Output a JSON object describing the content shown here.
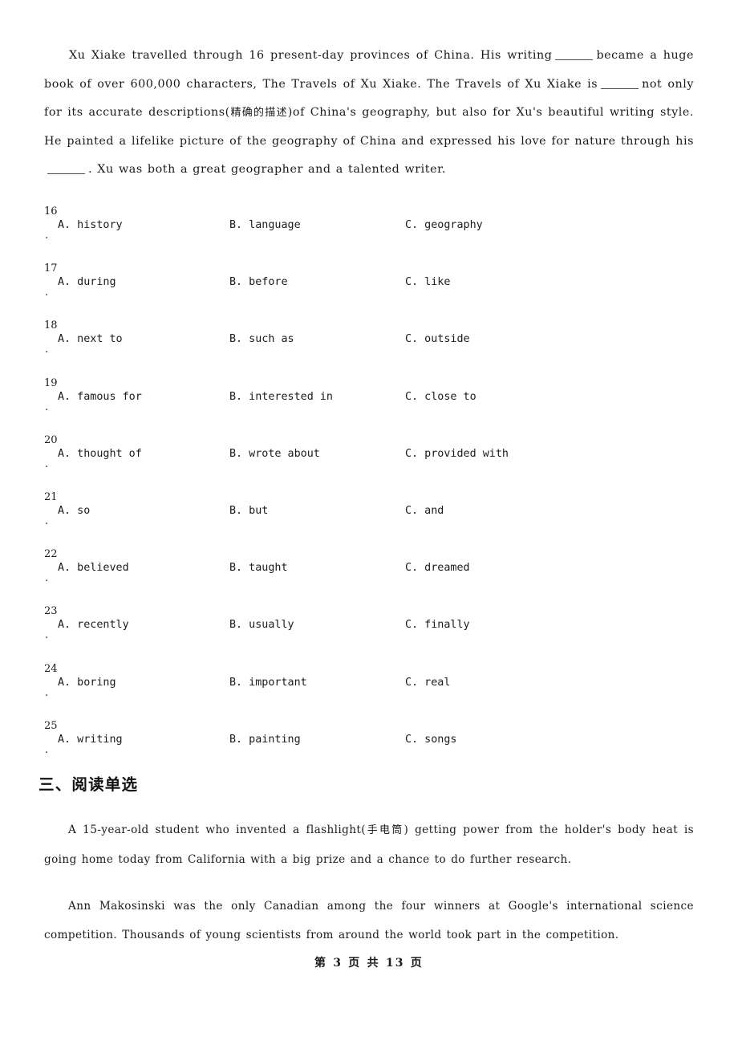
{
  "document": {
    "cloze_passage": {
      "lines": [
        "Xu Xiake travelled through 16 present-day provinces of China. His writing",
        "became a huge book of over 600,000 characters, The Travels of Xu Xiake. The Travels of Xu Xiake is",
        "not only for its accurate descriptions(精确的描述)of China's geography, but also for Xu's beautiful writing style. He painted a lifelike picture of the geography of China and expressed his love for nature through his",
        ". Xu was both a great geographer and a talented writer."
      ],
      "segment_1": "Xu Xiake travelled through 16 present-day provinces of China. His writing",
      "segment_2": "became a huge book of over 600,000 characters, The Travels of Xu Xiake. The Travels of Xu Xiake is",
      "segment_3_pre": "not only for its accurate descriptions(",
      "segment_3_cn": "精确的描述",
      "segment_3_post": ")of China's geography, but also for Xu's beautiful writing style. He painted a lifelike picture of the geography of China and expressed his love for nature through his",
      "segment_4": ". Xu was both a great geographer and a talented writer."
    },
    "questions": [
      {
        "number": "16",
        "dot": ".",
        "a": "A. history",
        "b": "B. language",
        "c": "C. geography"
      },
      {
        "number": "17",
        "dot": ".",
        "a": "A. during",
        "b": "B. before",
        "c": "C. like"
      },
      {
        "number": "18",
        "dot": ".",
        "a": "A. next to",
        "b": "B. such as",
        "c": "C. outside"
      },
      {
        "number": "19",
        "dot": ".",
        "a": "A. famous for",
        "b": "B. interested in",
        "c": "C. close to"
      },
      {
        "number": "20",
        "dot": ".",
        "a": "A. thought of",
        "b": "B. wrote about",
        "c": "C. provided with"
      },
      {
        "number": "21",
        "dot": ".",
        "a": "A. so",
        "b": "B. but",
        "c": "C. and"
      },
      {
        "number": "22",
        "dot": ".",
        "a": "A. believed",
        "b": "B. taught",
        "c": "C. dreamed"
      },
      {
        "number": "23",
        "dot": ".",
        "a": "A. recently",
        "b": "B. usually",
        "c": "C. finally"
      },
      {
        "number": "24",
        "dot": ".",
        "a": "A. boring",
        "b": "B. important",
        "c": "C. real"
      },
      {
        "number": "25",
        "dot": ".",
        "a": "A. writing",
        "b": "B. painting",
        "c": "C. songs"
      }
    ],
    "section_heading": "三、阅读单选",
    "reading": {
      "paragraph_1_pre": "A 15-year-old student who invented a flashlight(",
      "paragraph_1_cn": "手电筒",
      "paragraph_1_post": ") getting power from the holder's body heat is going home today from California with a big prize and a chance to do further research.",
      "paragraph_2": "Ann Makosinski was the only Canadian among the four winners at Google's international science competition. Thousands of young scientists from around the world took part in the competition."
    },
    "footer": {
      "text": "第 3 页 共 13 页",
      "current_page": "3",
      "total_pages": "13"
    }
  }
}
